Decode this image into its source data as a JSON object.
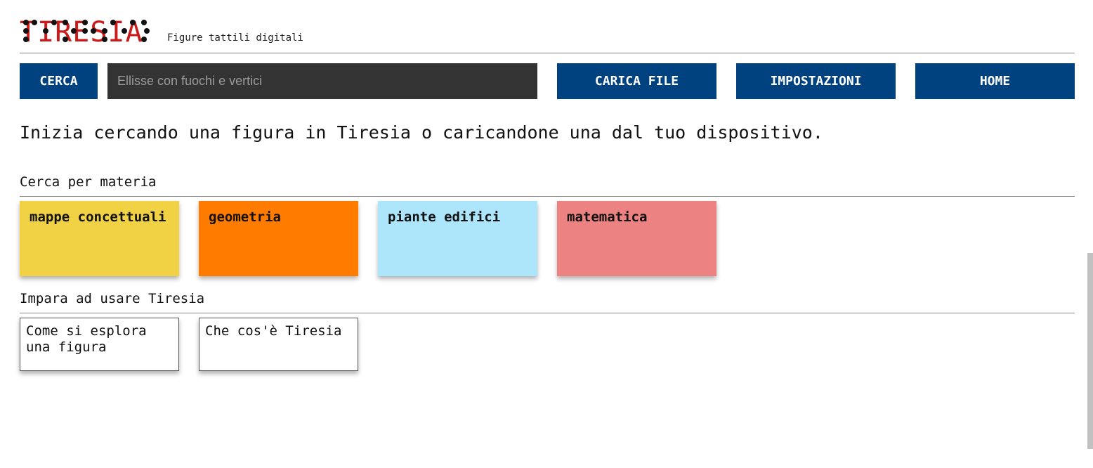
{
  "header": {
    "logo_text": "TIRESIA",
    "tagline": "Figure tattili digitali"
  },
  "toolbar": {
    "search_button": "CERCA",
    "search_placeholder": "Ellisse con fuochi e vertici",
    "upload_button": "CARICA FILE",
    "settings_button": "IMPOSTAZIONI",
    "home_button": "HOME"
  },
  "intro_text": "Inizia cercando una figura in Tiresia o caricandone una dal tuo dispositivo.",
  "subjects": {
    "title": "Cerca per materia",
    "items": [
      {
        "label": "mappe concettuali",
        "color": "#f0d244"
      },
      {
        "label": "geometria",
        "color": "#ff7c00"
      },
      {
        "label": "piante edifici",
        "color": "#ade6fb"
      },
      {
        "label": "matematica",
        "color": "#ec8282"
      }
    ]
  },
  "learn": {
    "title": "Impara ad usare Tiresia",
    "items": [
      {
        "label": "Come si esplora una figura"
      },
      {
        "label": "Che cos'è Tiresia"
      }
    ]
  }
}
